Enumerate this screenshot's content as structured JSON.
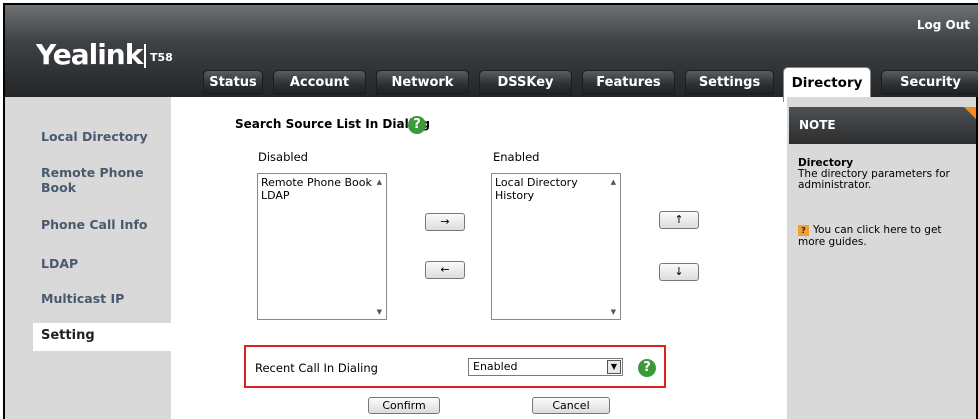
{
  "brand": {
    "logo_text": "Yealink",
    "model": "T58"
  },
  "header": {
    "logout_label": "Log Out",
    "tabs": [
      {
        "label": "Status"
      },
      {
        "label": "Account"
      },
      {
        "label": "Network"
      },
      {
        "label": "DSSKey"
      },
      {
        "label": "Features"
      },
      {
        "label": "Settings"
      },
      {
        "label": "Directory",
        "active": true
      },
      {
        "label": "Security"
      }
    ]
  },
  "sidebar": {
    "items": [
      {
        "label": "Local Directory"
      },
      {
        "label": "Remote Phone Book"
      },
      {
        "label": "Phone Call Info"
      },
      {
        "label": "LDAP"
      },
      {
        "label": "Multicast IP"
      },
      {
        "label": "Setting",
        "active": true
      }
    ]
  },
  "main": {
    "section_title": "Search Source List In Dialing",
    "help_icon": "question-circle-icon",
    "disabled_label": "Disabled",
    "enabled_label": "Enabled",
    "disabled_items": [
      "Remote Phone Book",
      "LDAP"
    ],
    "enabled_items": [
      "Local Directory",
      "History"
    ],
    "move_right_glyph": "→",
    "move_left_glyph": "←",
    "move_up_glyph": "↑",
    "move_down_glyph": "↓",
    "recent_call": {
      "label": "Recent Call In Dialing",
      "value": "Enabled",
      "dropdown_glyph": "▼"
    },
    "confirm_label": "Confirm",
    "cancel_label": "Cancel"
  },
  "note": {
    "title": "NOTE",
    "heading": "Directory",
    "line1": "The directory parameters for",
    "line2": "administrator.",
    "guide_icon_glyph": "?",
    "guide_line1": "You can click here to get",
    "guide_line2": "more guides."
  },
  "colors": {
    "accent_border": "#e02020",
    "help_icon": "#3c9a3c",
    "note_corner": "#f08a24",
    "sidebar_text": "#4a5a6e"
  }
}
